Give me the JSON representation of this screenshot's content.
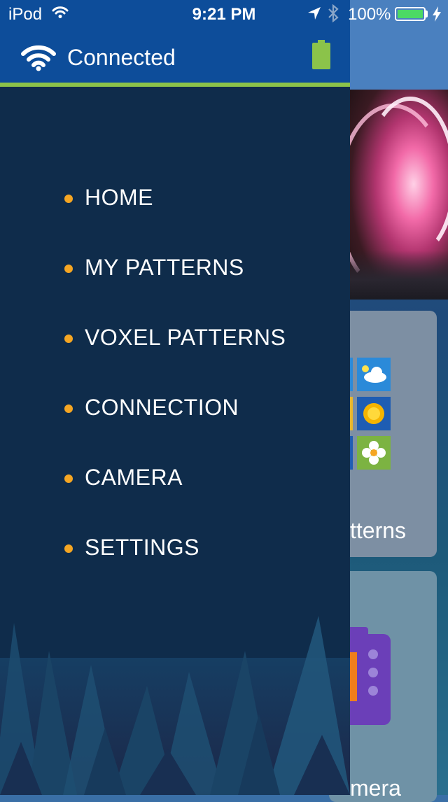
{
  "status_bar": {
    "carrier": "iPod",
    "time": "9:21 PM",
    "battery_percent": "100%",
    "battery_level": 1.0
  },
  "drawer": {
    "connection_status": "Connected",
    "accent_color": "#8bc34a",
    "bullet_color": "#f5a623",
    "menu": [
      {
        "label": "HOME"
      },
      {
        "label": "MY PATTERNS"
      },
      {
        "label": "VOXEL PATTERNS"
      },
      {
        "label": "CONNECTION"
      },
      {
        "label": "CAMERA"
      },
      {
        "label": "SETTINGS"
      }
    ]
  },
  "background_app": {
    "cards": [
      {
        "label_visible": "tterns",
        "icons": [
          "cloud-icon",
          "sun-icon",
          "flower-icon"
        ]
      },
      {
        "label_visible": "mera",
        "icons": [
          "camera-device-icon"
        ]
      }
    ]
  }
}
